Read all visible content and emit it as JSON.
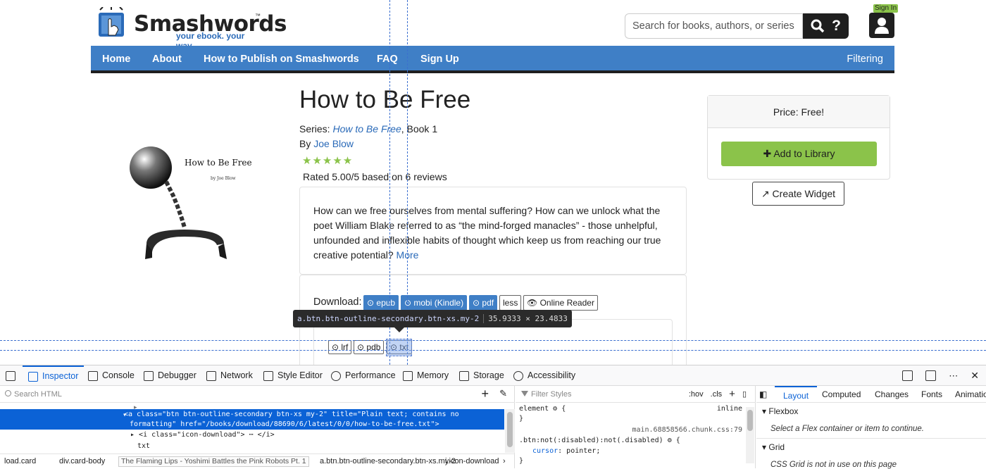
{
  "header": {
    "logo_word": "Smashwords",
    "logo_tm": "™",
    "logo_tagline": "your ebook. your way.",
    "search_placeholder": "Search for books, authors, or series.",
    "search_icon_glyph": "🔍",
    "help_glyph": "?",
    "signin_label": "Sign In"
  },
  "nav": {
    "items": [
      "Home",
      "About",
      "How to Publish on Smashwords",
      "FAQ",
      "Sign Up"
    ],
    "filter_label": "Filtering"
  },
  "book": {
    "cover_title": "How to Be Free",
    "cover_author": "by Joe Blow",
    "title": "How to Be Free",
    "series_prefix": "Series: ",
    "series_name": "How to Be Free",
    "series_suffix": ", Book 1",
    "by_prefix": "By ",
    "author": "Joe Blow",
    "stars": "★★★★★",
    "rating_text": "Rated 5.00/5 based on 6 reviews",
    "description": "How can we free ourselves from mental suffering? How can we unlock what the poet William Blake referred to as “the mind-forged manacles” - those unhelpful, unfounded and inflexible habits of thought which keep us from reaching our true creative potential?",
    "more_link": "More"
  },
  "download": {
    "label": "Download:",
    "primary": [
      "⊙ epub",
      "⊙ mobi (Kindle)",
      "⊙ pdf"
    ],
    "less": "less",
    "online_reader": "👁 Online Reader",
    "secondary": [
      "⊙ lrf",
      "⊙ pdb",
      "⊙ txt"
    ]
  },
  "sidebar": {
    "price": "Price: Free!",
    "add_to_library": "✚ Add to Library",
    "create_widget": "↗ Create Widget"
  },
  "inspector_tooltip": {
    "selector": "a.btn.btn-outline-secondary.btn-xs.my-2",
    "dimensions": "35.9333 × 23.4833"
  },
  "devtools": {
    "tabs": [
      "Inspector",
      "Console",
      "Debugger",
      "Network",
      "Style Editor",
      "Performance",
      "Memory",
      "Storage",
      "Accessibility"
    ],
    "search_html_placeholder": "Search HTML",
    "selected_line_1": "<a class=\"btn btn-outline-secondary btn-xs my-2\" title=\"Plain text; contains no",
    "selected_line_2": "formatting\" href=\"/books/download/88690/6/latest/0/0/how-to-be-free.txt\">",
    "child_line": "<i class=\"icon-download\"> ⋯ </i>",
    "text_line": "txt",
    "breadcrumbs": [
      "load.card",
      "div.card-body",
      "a.btn.btn-outline-secondary.btn-xs.my-2",
      "i.icon-download"
    ],
    "breadcrumb_tooltip": "The Flaming Lips - Yoshimi Battles the Pink Robots Pt. 1",
    "filter_styles_placeholder": "Filter Styles",
    "styles_tools": [
      ":hov",
      ".cls",
      "+"
    ],
    "element_rule": "element",
    "element_inline": "inline",
    "stylesheet": "main.68858566.chunk.css:79",
    "rule_selector": ".btn:not(:disabled):not(.disabled)",
    "rule_prop": "cursor",
    "rule_value": "pointer;",
    "layout_tabs": [
      "Layout",
      "Computed",
      "Changes",
      "Fonts",
      "Animations"
    ],
    "flexbox_title": "Flexbox",
    "flexbox_note": "Select a Flex container or item to continue.",
    "grid_title": "Grid",
    "grid_note": "CSS Grid is not in use on this page"
  }
}
